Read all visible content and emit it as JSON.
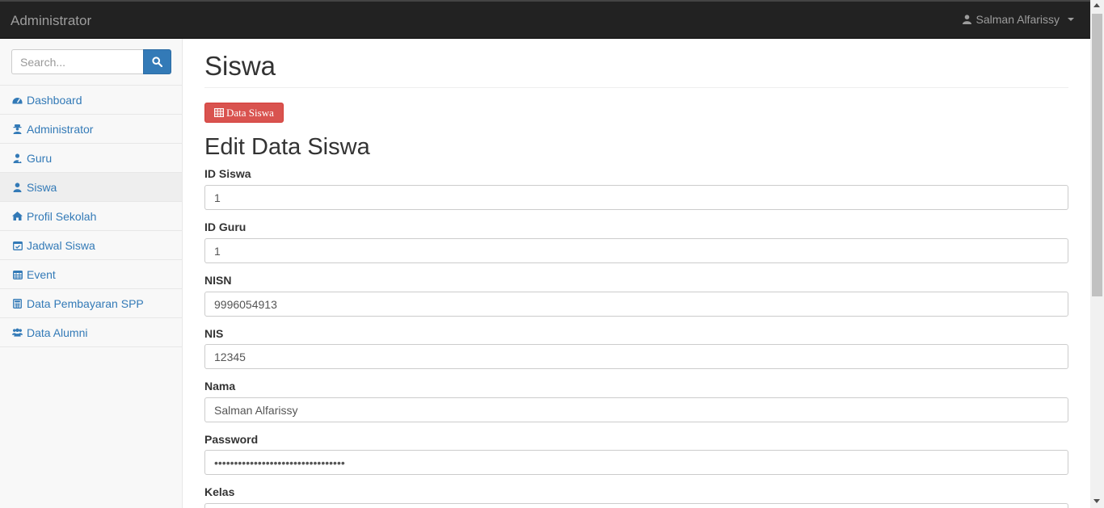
{
  "topbar": {
    "brand": "Administrator",
    "user_name": "Salman Alfarissy"
  },
  "sidebar": {
    "search_placeholder": "Search...",
    "items": [
      {
        "label": "Dashboard",
        "icon": "dashboard-icon"
      },
      {
        "label": "Administrator",
        "icon": "user-secret-icon"
      },
      {
        "label": "Guru",
        "icon": "user-md-icon"
      },
      {
        "label": "Siswa",
        "icon": "user-icon",
        "active": true
      },
      {
        "label": "Profil Sekolah",
        "icon": "home-icon"
      },
      {
        "label": "Jadwal Siswa",
        "icon": "calendar-check-icon"
      },
      {
        "label": "Event",
        "icon": "calendar-icon"
      },
      {
        "label": "Data Pembayaran SPP",
        "icon": "calculator-icon"
      },
      {
        "label": "Data Alumni",
        "icon": "users-icon"
      }
    ]
  },
  "main": {
    "page_title": "Siswa",
    "data_button_label": "Data Siswa",
    "section_title": "Edit Data Siswa",
    "fields": [
      {
        "label": "ID Siswa",
        "value": "1"
      },
      {
        "label": "ID Guru",
        "value": "1"
      },
      {
        "label": "NISN",
        "value": "9996054913"
      },
      {
        "label": "NIS",
        "value": "12345"
      },
      {
        "label": "Nama",
        "value": "Salman Alfarissy"
      },
      {
        "label": "Password",
        "value": "•••••••••••••••••••••••••••••••••"
      },
      {
        "label": "Kelas",
        "value": ""
      }
    ]
  },
  "colors": {
    "navbar_bg": "#222222",
    "link_blue": "#337ab7",
    "danger_red": "#d9534f"
  }
}
